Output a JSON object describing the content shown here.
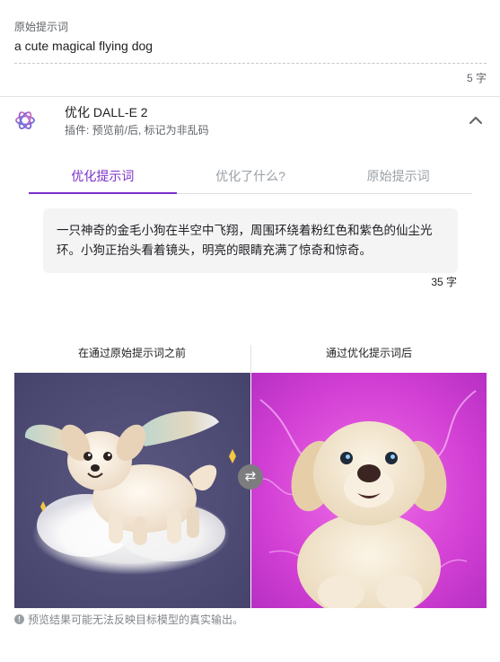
{
  "prompt": {
    "caption": "原始提示词",
    "value": "a cute magical flying dog",
    "count": "5 字"
  },
  "plugin": {
    "title": "优化 DALL-E 2",
    "subtitle": "插件: 预览前/后, 标记为非乱码",
    "logo_icon": "openai-logo-icon",
    "collapse_icon": "chevron-up-icon"
  },
  "tabs": [
    {
      "label": "优化提示词",
      "active": true
    },
    {
      "label": "优化了什么?",
      "active": false
    },
    {
      "label": "原始提示词",
      "active": false
    }
  ],
  "optimized": {
    "text": "一只神奇的金毛小狗在半空中飞翔，周围环绕着粉红色和紫色的仙尘光环。小狗正抬头看着镜头，明亮的眼睛充满了惊奇和惊奇。",
    "count": "35 字"
  },
  "comparison": {
    "before_label": "在通过原始提示词之前",
    "after_label": "通过优化提示词后",
    "swap_icon": "swap-arrows-icon"
  },
  "note": {
    "text": "预览结果可能无法反映目标模型的真实输出。",
    "icon": "info-icon"
  },
  "colors": {
    "accent": "#7b2fc9",
    "left_bg": "#4d4b72",
    "right_bg": "#d63fd6"
  }
}
